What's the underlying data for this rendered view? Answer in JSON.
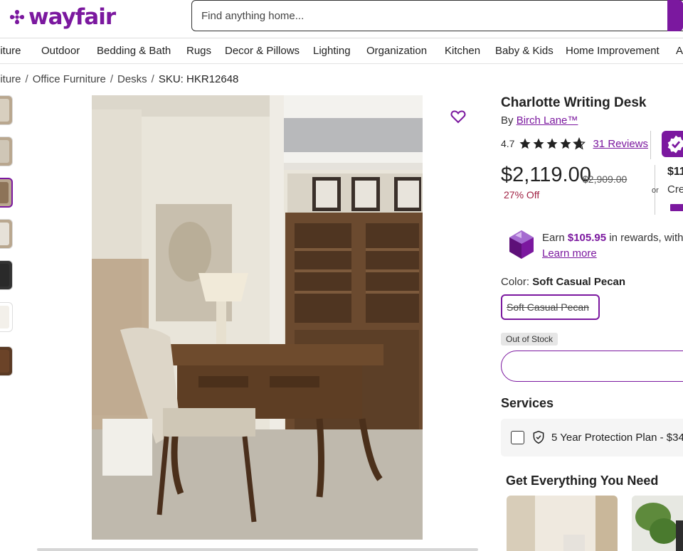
{
  "brand": {
    "name": "wayfair",
    "color": "#7b189f"
  },
  "search": {
    "placeholder": "Find anything home..."
  },
  "nav": {
    "items": [
      "niture",
      "Outdoor",
      "Bedding & Bath",
      "Rugs",
      "Decor & Pillows",
      "Lighting",
      "Organization",
      "Kitchen",
      "Baby & Kids",
      "Home Improvement",
      "Ap"
    ]
  },
  "breadcrumb": {
    "items": [
      "niture",
      "Office Furniture",
      "Desks"
    ],
    "current": "SKU: HKR12648",
    "separator": "/"
  },
  "product": {
    "title": "Charlotte Writing Desk",
    "by_label": "By",
    "brand": "Birch Lane™",
    "rating": "4.7",
    "stars_value": 4.7,
    "reviews": "31 Reviews",
    "price": "$2,119.00",
    "old_price": "$2,909.00",
    "discount": "27% Off",
    "or_label": "or",
    "alt_price": "$11",
    "alt_credit": "Cre",
    "rewards_prefix": "Earn",
    "rewards_amount": "$105.95",
    "rewards_suffix": "in rewards, with",
    "learn_more": "Learn more",
    "color_label": "Color:",
    "color_value": "Soft Casual Pecan",
    "swatch_label": "Soft Casual Pecan",
    "stock_status": "Out of Stock"
  },
  "services": {
    "heading": "Services",
    "plan": "5 Year Protection Plan - $34"
  },
  "recommendations": {
    "heading": "Get Everything You Need"
  },
  "icons": {
    "heart": "heart-outline-icon",
    "star": "star-icon",
    "shield": "shield-check-icon",
    "gem": "rewards-gem-icon",
    "badge": "verified-badge-icon"
  }
}
